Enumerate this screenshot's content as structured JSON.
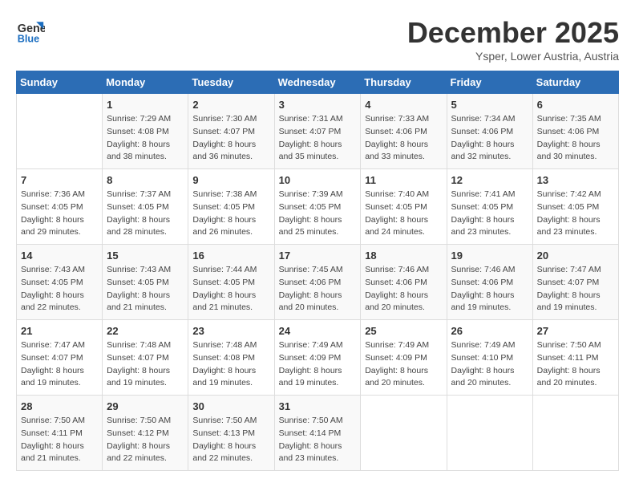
{
  "header": {
    "logo_line1": "General",
    "logo_line2": "Blue",
    "month": "December 2025",
    "location": "Ysper, Lower Austria, Austria"
  },
  "weekdays": [
    "Sunday",
    "Monday",
    "Tuesday",
    "Wednesday",
    "Thursday",
    "Friday",
    "Saturday"
  ],
  "weeks": [
    [
      {
        "day": "",
        "sunrise": "",
        "sunset": "",
        "daylight": ""
      },
      {
        "day": "1",
        "sunrise": "Sunrise: 7:29 AM",
        "sunset": "Sunset: 4:08 PM",
        "daylight": "Daylight: 8 hours and 38 minutes."
      },
      {
        "day": "2",
        "sunrise": "Sunrise: 7:30 AM",
        "sunset": "Sunset: 4:07 PM",
        "daylight": "Daylight: 8 hours and 36 minutes."
      },
      {
        "day": "3",
        "sunrise": "Sunrise: 7:31 AM",
        "sunset": "Sunset: 4:07 PM",
        "daylight": "Daylight: 8 hours and 35 minutes."
      },
      {
        "day": "4",
        "sunrise": "Sunrise: 7:33 AM",
        "sunset": "Sunset: 4:06 PM",
        "daylight": "Daylight: 8 hours and 33 minutes."
      },
      {
        "day": "5",
        "sunrise": "Sunrise: 7:34 AM",
        "sunset": "Sunset: 4:06 PM",
        "daylight": "Daylight: 8 hours and 32 minutes."
      },
      {
        "day": "6",
        "sunrise": "Sunrise: 7:35 AM",
        "sunset": "Sunset: 4:06 PM",
        "daylight": "Daylight: 8 hours and 30 minutes."
      }
    ],
    [
      {
        "day": "7",
        "sunrise": "Sunrise: 7:36 AM",
        "sunset": "Sunset: 4:05 PM",
        "daylight": "Daylight: 8 hours and 29 minutes."
      },
      {
        "day": "8",
        "sunrise": "Sunrise: 7:37 AM",
        "sunset": "Sunset: 4:05 PM",
        "daylight": "Daylight: 8 hours and 28 minutes."
      },
      {
        "day": "9",
        "sunrise": "Sunrise: 7:38 AM",
        "sunset": "Sunset: 4:05 PM",
        "daylight": "Daylight: 8 hours and 26 minutes."
      },
      {
        "day": "10",
        "sunrise": "Sunrise: 7:39 AM",
        "sunset": "Sunset: 4:05 PM",
        "daylight": "Daylight: 8 hours and 25 minutes."
      },
      {
        "day": "11",
        "sunrise": "Sunrise: 7:40 AM",
        "sunset": "Sunset: 4:05 PM",
        "daylight": "Daylight: 8 hours and 24 minutes."
      },
      {
        "day": "12",
        "sunrise": "Sunrise: 7:41 AM",
        "sunset": "Sunset: 4:05 PM",
        "daylight": "Daylight: 8 hours and 23 minutes."
      },
      {
        "day": "13",
        "sunrise": "Sunrise: 7:42 AM",
        "sunset": "Sunset: 4:05 PM",
        "daylight": "Daylight: 8 hours and 23 minutes."
      }
    ],
    [
      {
        "day": "14",
        "sunrise": "Sunrise: 7:43 AM",
        "sunset": "Sunset: 4:05 PM",
        "daylight": "Daylight: 8 hours and 22 minutes."
      },
      {
        "day": "15",
        "sunrise": "Sunrise: 7:43 AM",
        "sunset": "Sunset: 4:05 PM",
        "daylight": "Daylight: 8 hours and 21 minutes."
      },
      {
        "day": "16",
        "sunrise": "Sunrise: 7:44 AM",
        "sunset": "Sunset: 4:05 PM",
        "daylight": "Daylight: 8 hours and 21 minutes."
      },
      {
        "day": "17",
        "sunrise": "Sunrise: 7:45 AM",
        "sunset": "Sunset: 4:06 PM",
        "daylight": "Daylight: 8 hours and 20 minutes."
      },
      {
        "day": "18",
        "sunrise": "Sunrise: 7:46 AM",
        "sunset": "Sunset: 4:06 PM",
        "daylight": "Daylight: 8 hours and 20 minutes."
      },
      {
        "day": "19",
        "sunrise": "Sunrise: 7:46 AM",
        "sunset": "Sunset: 4:06 PM",
        "daylight": "Daylight: 8 hours and 19 minutes."
      },
      {
        "day": "20",
        "sunrise": "Sunrise: 7:47 AM",
        "sunset": "Sunset: 4:07 PM",
        "daylight": "Daylight: 8 hours and 19 minutes."
      }
    ],
    [
      {
        "day": "21",
        "sunrise": "Sunrise: 7:47 AM",
        "sunset": "Sunset: 4:07 PM",
        "daylight": "Daylight: 8 hours and 19 minutes."
      },
      {
        "day": "22",
        "sunrise": "Sunrise: 7:48 AM",
        "sunset": "Sunset: 4:07 PM",
        "daylight": "Daylight: 8 hours and 19 minutes."
      },
      {
        "day": "23",
        "sunrise": "Sunrise: 7:48 AM",
        "sunset": "Sunset: 4:08 PM",
        "daylight": "Daylight: 8 hours and 19 minutes."
      },
      {
        "day": "24",
        "sunrise": "Sunrise: 7:49 AM",
        "sunset": "Sunset: 4:09 PM",
        "daylight": "Daylight: 8 hours and 19 minutes."
      },
      {
        "day": "25",
        "sunrise": "Sunrise: 7:49 AM",
        "sunset": "Sunset: 4:09 PM",
        "daylight": "Daylight: 8 hours and 20 minutes."
      },
      {
        "day": "26",
        "sunrise": "Sunrise: 7:49 AM",
        "sunset": "Sunset: 4:10 PM",
        "daylight": "Daylight: 8 hours and 20 minutes."
      },
      {
        "day": "27",
        "sunrise": "Sunrise: 7:50 AM",
        "sunset": "Sunset: 4:11 PM",
        "daylight": "Daylight: 8 hours and 20 minutes."
      }
    ],
    [
      {
        "day": "28",
        "sunrise": "Sunrise: 7:50 AM",
        "sunset": "Sunset: 4:11 PM",
        "daylight": "Daylight: 8 hours and 21 minutes."
      },
      {
        "day": "29",
        "sunrise": "Sunrise: 7:50 AM",
        "sunset": "Sunset: 4:12 PM",
        "daylight": "Daylight: 8 hours and 22 minutes."
      },
      {
        "day": "30",
        "sunrise": "Sunrise: 7:50 AM",
        "sunset": "Sunset: 4:13 PM",
        "daylight": "Daylight: 8 hours and 22 minutes."
      },
      {
        "day": "31",
        "sunrise": "Sunrise: 7:50 AM",
        "sunset": "Sunset: 4:14 PM",
        "daylight": "Daylight: 8 hours and 23 minutes."
      },
      {
        "day": "",
        "sunrise": "",
        "sunset": "",
        "daylight": ""
      },
      {
        "day": "",
        "sunrise": "",
        "sunset": "",
        "daylight": ""
      },
      {
        "day": "",
        "sunrise": "",
        "sunset": "",
        "daylight": ""
      }
    ]
  ]
}
